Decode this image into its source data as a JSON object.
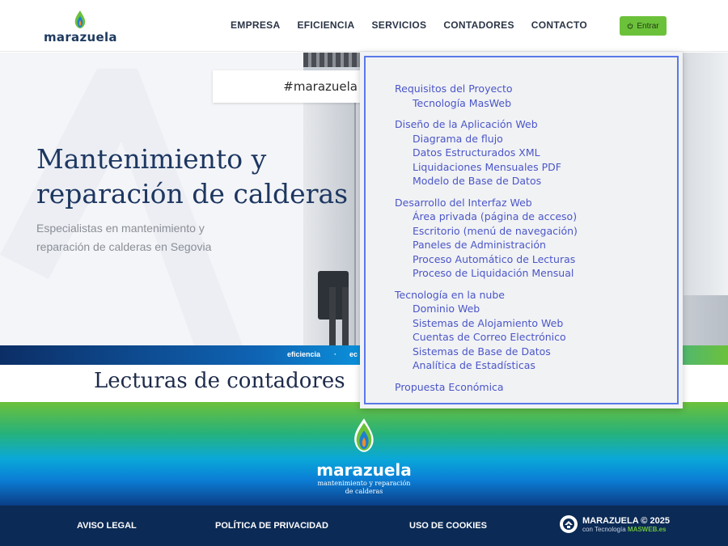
{
  "header": {
    "logo_text": "marazuela",
    "nav": [
      "EMPRESA",
      "EFICIENCIA",
      "SERVICIOS",
      "CONTADORES",
      "CONTACTO"
    ],
    "login_label": "Entrar"
  },
  "hero": {
    "hashtag": "#marazuela",
    "title_line1": "Mantenimiento y",
    "title_line2": "reparación de calderas",
    "subtitle_line1": "Especialistas en mantenimiento y",
    "subtitle_line2": "reparación de calderas en Segovia"
  },
  "stripe": {
    "words": [
      "eficiencia",
      "·",
      "ec"
    ]
  },
  "section": {
    "title": "Lecturas de contadores"
  },
  "footer": {
    "logo_text": "marazuela",
    "tagline_line1": "mantenimiento y reparación",
    "tagline_line2": "de calderas",
    "links": [
      "AVISO LEGAL",
      "POLÍTICA DE PRIVACIDAD",
      "USO DE COOKIES"
    ],
    "copyright": "MARAZUELA © 2025",
    "powered_prefix": "con Tecnología",
    "powered_brand": "MASWEB.es"
  },
  "dropdown": {
    "sections": [
      {
        "title": "Requisitos del Proyecto",
        "items": [
          "Tecnología MasWeb"
        ]
      },
      {
        "title": "Diseño de la Aplicación Web",
        "items": [
          "Diagrama de flujo",
          "Datos Estructurados XML",
          "Liquidaciones Mensuales PDF",
          "Modelo de Base de Datos"
        ]
      },
      {
        "title": "Desarrollo del Interfaz Web",
        "items": [
          "Área privada (página de acceso)",
          "Escritorio (menú de navegación)",
          "Paneles de Administración",
          "Proceso Automático de Lecturas",
          "Proceso de Liquidación Mensual"
        ]
      },
      {
        "title": "Tecnología en la nube",
        "items": [
          "Dominio Web",
          "Sistemas de Alojamiento Web",
          "Cuentas de Correo Electrónico",
          "Sistemas de Base de Datos",
          "Analítica de Estadísticas"
        ]
      },
      {
        "title": "Propuesta Económica",
        "items": []
      }
    ]
  },
  "colors": {
    "brand_navy": "#1d3761",
    "brand_green": "#6cc13b",
    "menu_link": "#4a56c8",
    "footer_bar": "#0b2a55"
  }
}
